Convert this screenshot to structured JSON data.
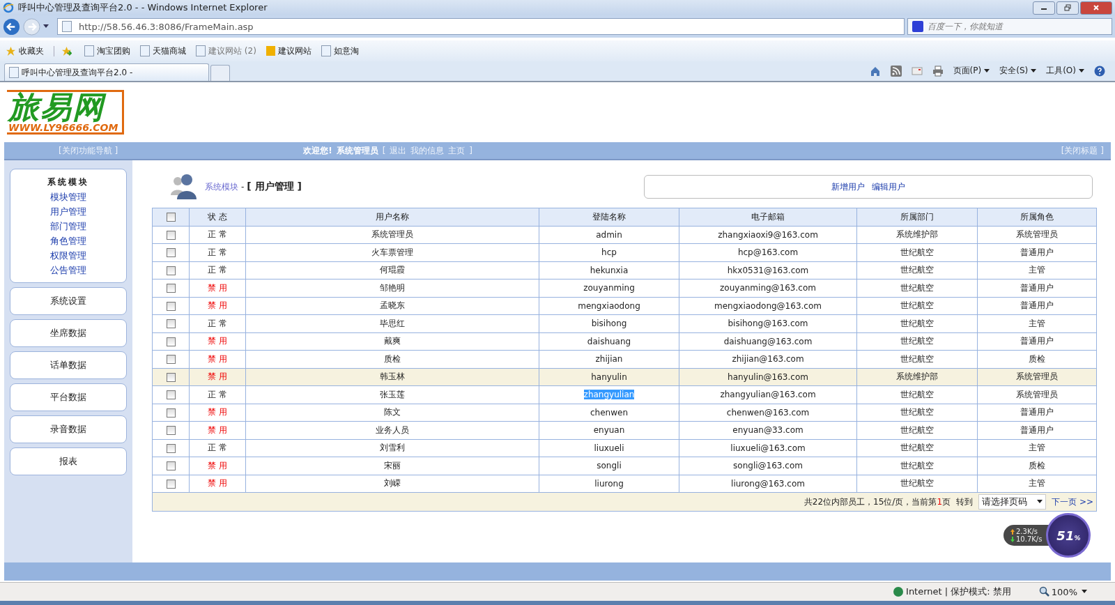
{
  "window": {
    "title": "呼叫中心管理及查询平台2.0 -   - Windows Internet Explorer"
  },
  "address_bar": {
    "url": "http://58.56.46.3:8086/FrameMain.asp"
  },
  "search": {
    "placeholder": "百度一下，你就知道"
  },
  "favorites": [
    {
      "label": "收藏夹",
      "kind": "star"
    },
    {
      "label": "淘宝团购",
      "kind": "page"
    },
    {
      "label": "天猫商城",
      "kind": "page"
    },
    {
      "label": "建议网站 (2)",
      "kind": "suggest"
    },
    {
      "label": "建议网站",
      "kind": "bing"
    },
    {
      "label": "如意淘",
      "kind": "page"
    }
  ],
  "tab": {
    "title": "呼叫中心管理及查询平台2.0 -"
  },
  "command_bar": [
    "页面(P)",
    "安全(S)",
    "工具(O)"
  ],
  "logo": {
    "name": "旅易网",
    "url": "WWW.LY96666.COM"
  },
  "nav": {
    "left": "[关闭功能导航 ]",
    "welcome": "欢迎您!",
    "user": "系统管理员",
    "open": "[",
    "links": [
      "退出",
      "我的信息",
      "主页"
    ],
    "close": "]",
    "right": "[关闭标题 ]"
  },
  "breadcrumb": {
    "parent": "系统模块",
    "separator": "-",
    "current": "[ 用户管理 ]"
  },
  "actions": [
    "新增用户",
    "编辑用户"
  ],
  "sidebar": {
    "title": "系统模块",
    "items": [
      "模块管理",
      "用户管理",
      "部门管理",
      "角色管理",
      "权限管理",
      "公告管理"
    ],
    "buttons": [
      "系统设置",
      "坐席数据",
      "话单数据",
      "平台数据",
      "录音数据",
      "报表"
    ]
  },
  "table": {
    "select_all_checked": false,
    "columns": [
      "状 态",
      "用户名称",
      "登陆名称",
      "电子邮箱",
      "所属部门",
      "所属角色"
    ],
    "rows": [
      {
        "status": "正 常",
        "disabled": false,
        "name": "系统管理员",
        "login": "admin",
        "email": "zhangxiaoxi9@163.com",
        "dept": "系统维护部",
        "role": "系统管理员",
        "selected": false,
        "checked": false,
        "text_selected": false
      },
      {
        "status": "正 常",
        "disabled": false,
        "name": "火车票管理",
        "login": "hcp",
        "email": "hcp@163.com",
        "dept": "世纪航空",
        "role": "普通用户",
        "selected": false,
        "checked": false,
        "text_selected": false
      },
      {
        "status": "正 常",
        "disabled": false,
        "name": "何琨霞",
        "login": "hekunxia",
        "email": "hkx0531@163.com",
        "dept": "世纪航空",
        "role": "主管",
        "selected": false,
        "checked": false,
        "text_selected": false
      },
      {
        "status": "禁 用",
        "disabled": true,
        "name": "邹艳明",
        "login": "zouyanming",
        "email": "zouyanming@163.com",
        "dept": "世纪航空",
        "role": "普通用户",
        "selected": false,
        "checked": false,
        "text_selected": false
      },
      {
        "status": "禁 用",
        "disabled": true,
        "name": "孟晓东",
        "login": "mengxiaodong",
        "email": "mengxiaodong@163.com",
        "dept": "世纪航空",
        "role": "普通用户",
        "selected": false,
        "checked": false,
        "text_selected": false
      },
      {
        "status": "正 常",
        "disabled": false,
        "name": "毕思红",
        "login": "bisihong",
        "email": "bisihong@163.com",
        "dept": "世纪航空",
        "role": "主管",
        "selected": false,
        "checked": false,
        "text_selected": false
      },
      {
        "status": "禁 用",
        "disabled": true,
        "name": "戴爽",
        "login": "daishuang",
        "email": "daishuang@163.com",
        "dept": "世纪航空",
        "role": "普通用户",
        "selected": false,
        "checked": false,
        "text_selected": false
      },
      {
        "status": "禁 用",
        "disabled": true,
        "name": "质检",
        "login": "zhijian",
        "email": "zhijian@163.com",
        "dept": "世纪航空",
        "role": "质检",
        "selected": false,
        "checked": false,
        "text_selected": false
      },
      {
        "status": "禁 用",
        "disabled": true,
        "name": "韩玉林",
        "login": "hanyulin",
        "email": "hanyulin@163.com",
        "dept": "系统维护部",
        "role": "系统管理员",
        "selected": true,
        "checked": false,
        "text_selected": false
      },
      {
        "status": "正 常",
        "disabled": false,
        "name": "张玉莲",
        "login": "zhangyulian",
        "email": "zhangyulian@163.com",
        "dept": "世纪航空",
        "role": "系统管理员",
        "selected": false,
        "checked": false,
        "text_selected": true
      },
      {
        "status": "禁 用",
        "disabled": true,
        "name": "陈文",
        "login": "chenwen",
        "email": "chenwen@163.com",
        "dept": "世纪航空",
        "role": "普通用户",
        "selected": false,
        "checked": false,
        "text_selected": false
      },
      {
        "status": "禁 用",
        "disabled": true,
        "name": "业务人员",
        "login": "enyuan",
        "email": "enyuan@33.com",
        "dept": "世纪航空",
        "role": "普通用户",
        "selected": false,
        "checked": false,
        "text_selected": false
      },
      {
        "status": "正 常",
        "disabled": false,
        "name": "刘雪利",
        "login": "liuxueli",
        "email": "liuxueli@163.com",
        "dept": "世纪航空",
        "role": "主管",
        "selected": false,
        "checked": false,
        "text_selected": false
      },
      {
        "status": "禁 用",
        "disabled": true,
        "name": "宋丽",
        "login": "songli",
        "email": "songli@163.com",
        "dept": "世纪航空",
        "role": "质检",
        "selected": false,
        "checked": false,
        "text_selected": false
      },
      {
        "status": "禁 用",
        "disabled": true,
        "name": "刘嵘",
        "login": "liurong",
        "email": "liurong@163.com",
        "dept": "世纪航空",
        "role": "主管",
        "selected": false,
        "checked": false,
        "text_selected": false
      }
    ],
    "pager": {
      "summary": "共22位内部员工，15位/页，当前第",
      "current_page": "1",
      "page_suffix": "页",
      "goto": "转到",
      "select": "请选择页码",
      "next": "下一页 >>"
    }
  },
  "speed_widget": {
    "up": "2.3K/s",
    "down": "10.7K/s",
    "percent": "51",
    "percent_sign": "%"
  },
  "status_bar": {
    "zone": "Internet | 保护模式: 禁用",
    "zoom": "100%"
  }
}
